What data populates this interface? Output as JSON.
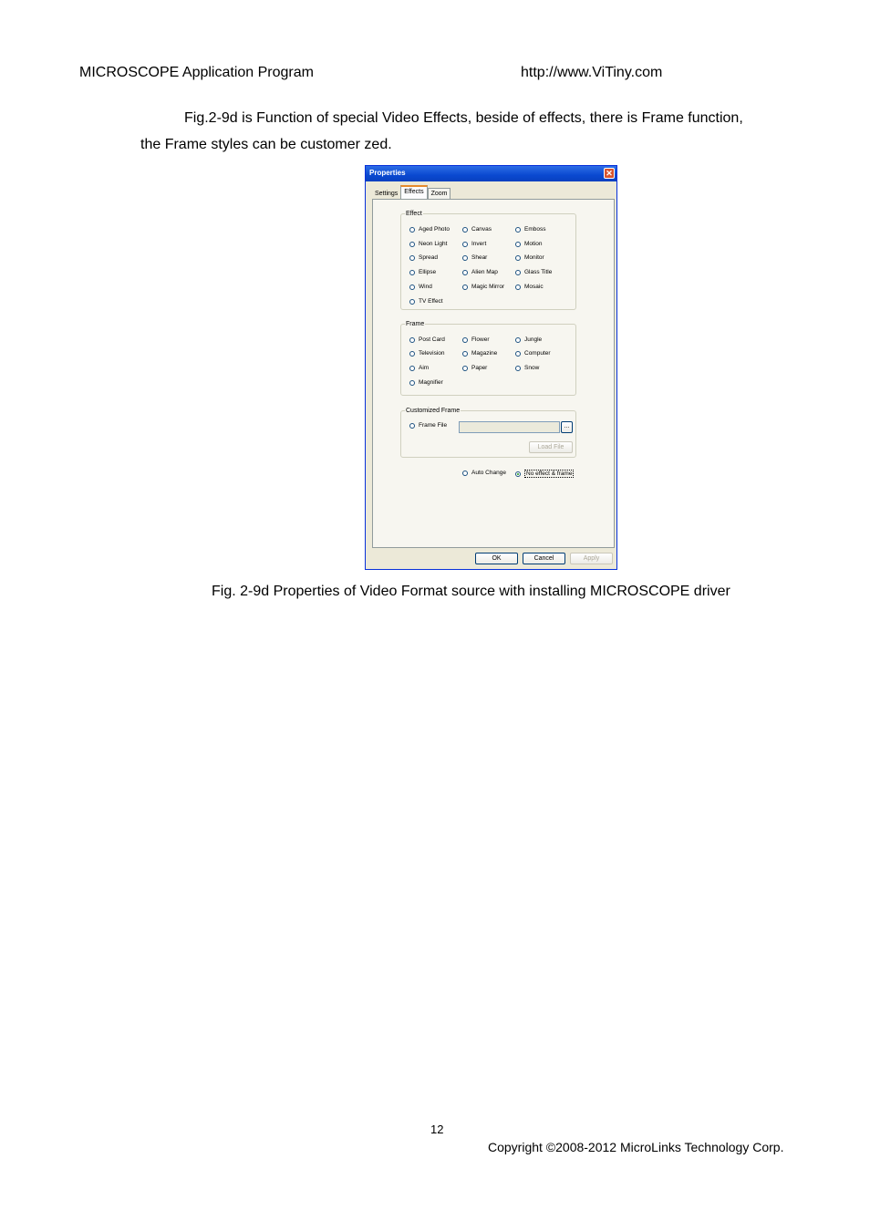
{
  "header": {
    "left": "MICROSCOPE Application Program",
    "right": "http://www.ViTiny.com"
  },
  "body": {
    "para_line1": "Fig.2-9d is Function of special Video Effects, beside of effects, there is Frame function,",
    "para_line2": "the Frame styles can be customer zed."
  },
  "dialog": {
    "title": "Properties",
    "close_glyph": "✕",
    "tabs": [
      "Settings",
      "Effects",
      "Zoom"
    ],
    "effect_group": {
      "label": "Effect",
      "options": [
        "Aged Photo",
        "Canvas",
        "Emboss",
        "Neon Light",
        "Invert",
        "Motion",
        "Spread",
        "Shear",
        "Monitor",
        "Ellipse",
        "Alien Map",
        "Glass Title",
        "Wind",
        "Magic Mirror",
        "Mosaic",
        "TV Effect"
      ]
    },
    "frame_group": {
      "label": "Frame",
      "options": [
        "Post Card",
        "Flower",
        "Jungle",
        "Television",
        "Magazine",
        "Computer",
        "Aim",
        "Paper",
        "Snow",
        "Magnifier"
      ]
    },
    "custom_group": {
      "label": "Customized Frame",
      "frame_file_label": "Frame File",
      "browse_label": "...",
      "load_label": "Load File"
    },
    "auto_change_label": "Auto Change",
    "no_effect_label": "No effect & frame",
    "ok_label": "OK",
    "cancel_label": "Cancel",
    "apply_label": "Apply"
  },
  "caption": "Fig. 2-9d Properties of Video Format source with installing MICROSCOPE driver",
  "footer": {
    "page_number": "12",
    "copyright": "Copyright ©2008-2012 MicroLinks Technology Corp."
  }
}
